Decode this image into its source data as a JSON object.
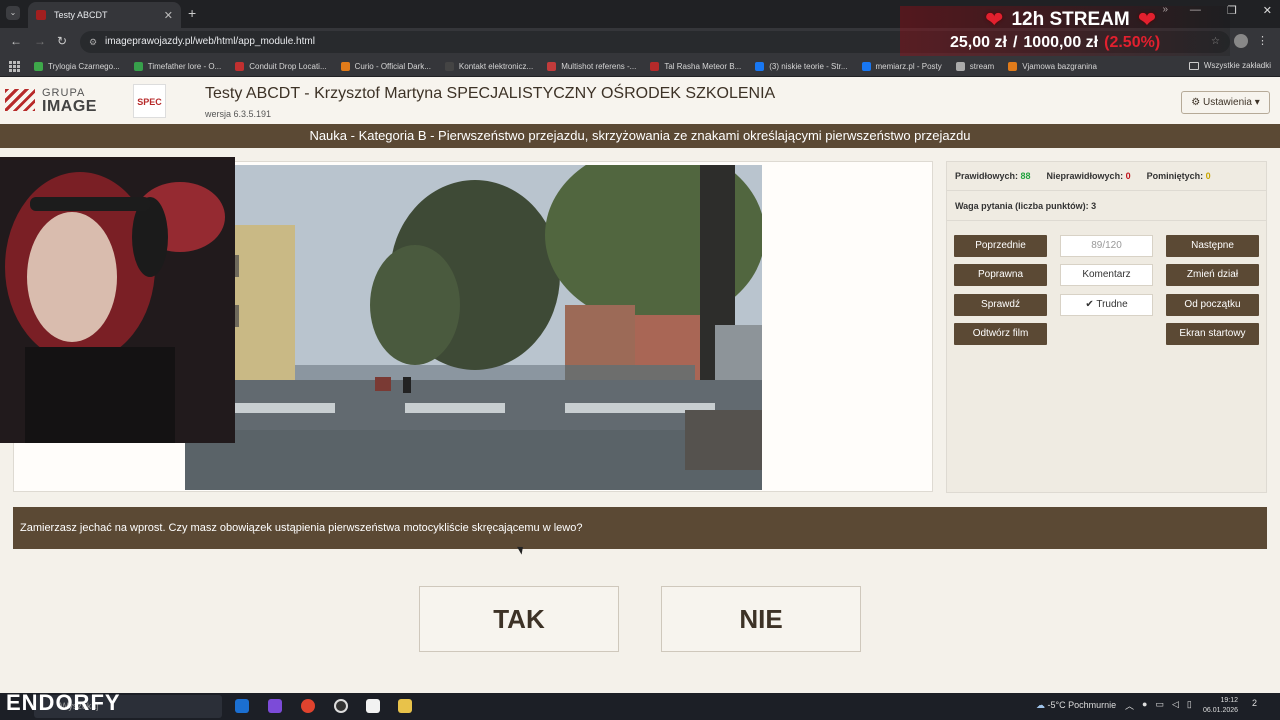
{
  "browser": {
    "tab_title": "Testy ABCDT",
    "url": "imageprawojazdy.pl/web/html/app_module.html",
    "bookmarks": [
      {
        "label": "Trylogia Czarnego...",
        "color": "#3ea84a"
      },
      {
        "label": "Timefather lore - O...",
        "color": "#37a04b"
      },
      {
        "label": "Conduit Drop Locati...",
        "color": "#c13030"
      },
      {
        "label": "Curio - Official Dark...",
        "color": "#e07b1a"
      },
      {
        "label": "Kontakt elektronicz...",
        "color": "#444444"
      },
      {
        "label": "Multishot referens -...",
        "color": "#c23b3b"
      },
      {
        "label": "Tal Rasha Meteor B...",
        "color": "#b52a2a"
      },
      {
        "label": "(3) niskie teorie - Str...",
        "color": "#1877f2"
      },
      {
        "label": "memiarz.pl - Posty",
        "color": "#1877f2"
      },
      {
        "label": "stream",
        "color": "#aaaaaa"
      },
      {
        "label": "Vjamowa bazgranina",
        "color": "#e07b1a"
      }
    ],
    "all_bookmarks": "Wszystkie zakładki"
  },
  "stream_overlay": {
    "title": "12h STREAM",
    "raised": "25,00 zł",
    "separator": "/",
    "goal": "1000,00 zł",
    "percent": "(2.50%)"
  },
  "header": {
    "logo_line1": "GRUPA",
    "logo_line2": "IMAGE",
    "spec_logo": "SPEC",
    "title": "Testy ABCDT - Krzysztof Martyna SPECJALISTYCZNY OŚRODEK SZKOLENIA",
    "version": "wersja 6.3.5.191",
    "settings_label": "Ustawienia"
  },
  "category": "Nauka - Kategoria B - Pierwszeństwo przejazdu, skrzyżowania ze znakami określającymi pierwszeństwo przejazdu",
  "stats": {
    "correct_label": "Prawidłowych:",
    "correct_value": "88",
    "incorrect_label": "Nieprawidłowych:",
    "incorrect_value": "0",
    "skipped_label": "Pominiętych:",
    "skipped_value": "0",
    "weight": "Waga pytania (liczba punktów): 3"
  },
  "controls": {
    "previous": "Poprzednie",
    "counter": "89/120",
    "next": "Następne",
    "correct": "Poprawna",
    "comment": "Komentarz",
    "change_section": "Zmień dział",
    "check": "Sprawdź",
    "difficult": "Trudne",
    "from_start": "Od początku",
    "play_movie": "Odtwórz film",
    "start_screen": "Ekran startowy"
  },
  "question": "Zamierzasz jechać na wprost. Czy masz obowiązek ustąpienia pierwszeństwa motocykliście skręcającemu w lewo?",
  "answers": {
    "yes": "TAK",
    "no": "NIE"
  },
  "taskbar": {
    "brand": "ENDORFY",
    "search": "Wyszukaj",
    "weather": "-5°C  Pochmurnie",
    "time": "19:12",
    "date": "06.01.2026",
    "notifications": "2"
  }
}
